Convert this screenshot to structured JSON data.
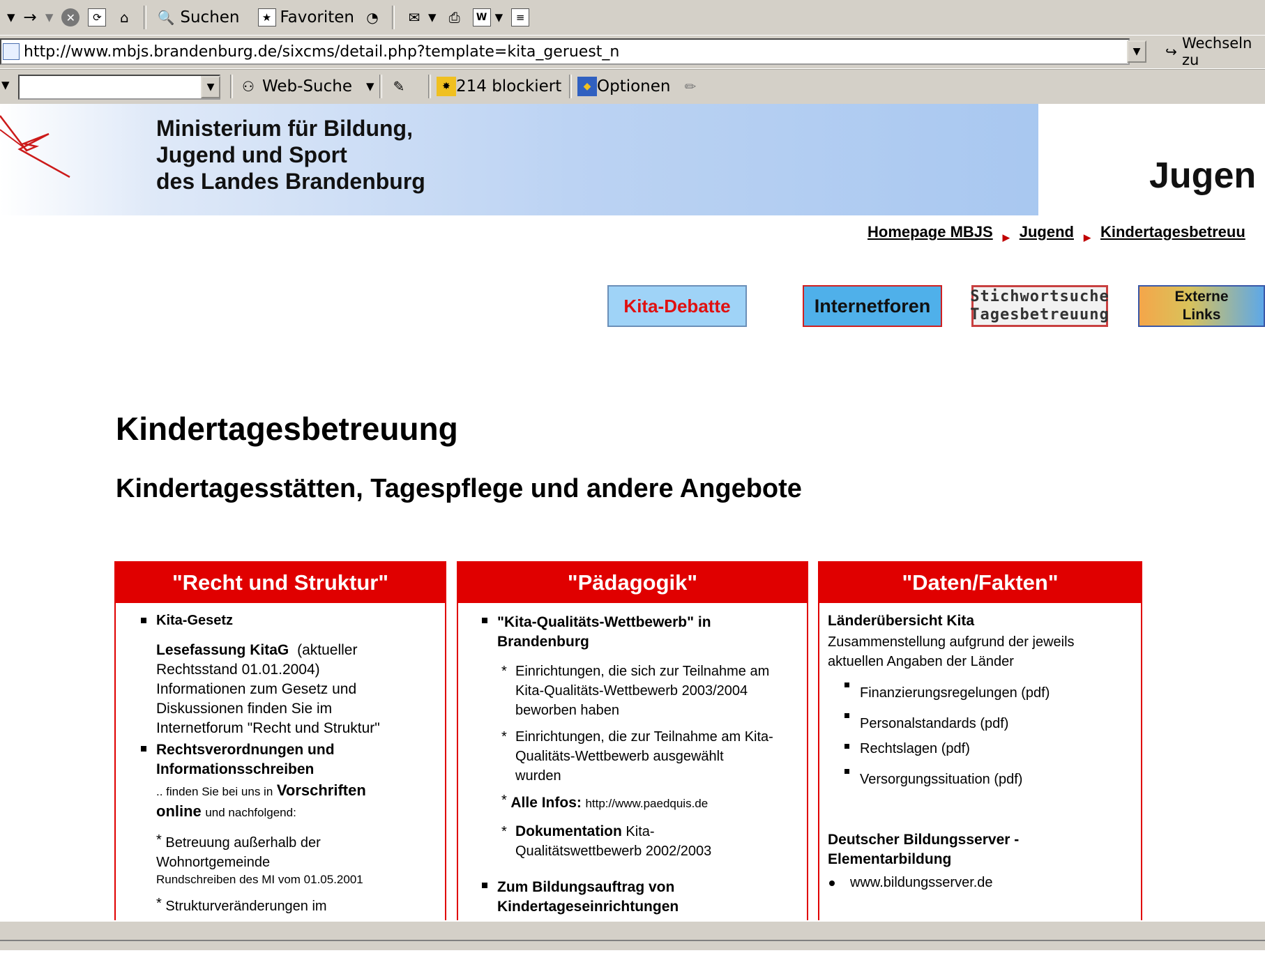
{
  "browser": {
    "toolbar": {
      "search_label": "Suchen",
      "favorites_label": "Favoriten"
    },
    "address": {
      "url": "http://www.mbjs.brandenburg.de/sixcms/detail.php?template=kita_geruest_n",
      "go_label": "Wechseln zu"
    },
    "searchbar": {
      "websuche_label": "Web-Suche",
      "blocked_label": "214 blockiert",
      "options_label": "Optionen"
    }
  },
  "banner": {
    "ministry_line1": "Ministerium für Bildung,",
    "ministry_line2": "Jugend und Sport",
    "ministry_line3": "des Landes Brandenburg",
    "section_title": "Jugen"
  },
  "breadcrumb": {
    "items": [
      "Homepage MBJS",
      "Jugend",
      "Kindertagesbetreuu"
    ]
  },
  "nav": {
    "kita_debatte": "Kita-Debatte",
    "internetforen": "Internetforen",
    "stichwort_line1": "Stichwortsuche",
    "stichwort_line2": "Tagesbetreuung",
    "externe_line1": "Externe",
    "externe_line2": "Links"
  },
  "headings": {
    "title": "Kindertagesbetreuung",
    "subtitle": "Kindertagesstätten, Tagespflege und andere Angebote"
  },
  "columns": {
    "recht": {
      "header": "\"Recht und Struktur\"",
      "kita_gesetz": "Kita-Gesetz",
      "lesefassung": "Lesefassung KitaG",
      "lesefassung_note": "(aktueller",
      "rechtsstand": "Rechtsstand 01.01.2004)",
      "info1": "Informationen zum Gesetz und",
      "info2": "Diskussionen finden Sie im",
      "info3": "Internetforum \"Recht und Struktur\"",
      "rv1": "Rechtsverordnungen und",
      "rv2": "Informationsschreiben",
      "finden_pre": ".. finden Sie bei uns in",
      "vorschriften": "Vorschriften",
      "online": "online",
      "finden_post": "und nachfolgend:",
      "betreuung1": "Betreuung außerhalb der",
      "betreuung2": "Wohnortgemeinde",
      "rundschreiben": "Rundschreiben des MI vom 01.05.2001",
      "struktur": "Strukturveränderungen im"
    },
    "paed": {
      "header": "\"Pädagogik\"",
      "wettbewerb1": "\"Kita-Qualitäts-Wettbewerb\" in",
      "wettbewerb2": "Brandenburg",
      "e1_1": "Einrichtungen, die sich zur Teilnahme am",
      "e1_2": "Kita-Qualitäts-Wettbewerb 2003/2004",
      "e1_3": "beworben haben",
      "e2_1": "Einrichtungen, die zur Teilnahme am Kita-",
      "e2_2": "Qualitäts-Wettbewerb ausgewählt",
      "e2_3": "wurden",
      "alle_infos": "Alle Infos:",
      "alle_infos_url": "http://www.paedquis.de",
      "doku": "Dokumentation",
      "doku_rest1": "Kita-",
      "doku_rest2": "Qualitätswettbewerb 2002/2003",
      "bildung1": "Zum Bildungsauftrag von",
      "bildung2": "Kindertageseinrichtungen"
    },
    "daten": {
      "header": "\"Daten/Fakten\"",
      "laender": "Länderübersicht Kita",
      "zus1": "Zusammenstellung aufgrund der jeweils",
      "zus2": "aktuellen Angaben der Länder",
      "items": [
        "Finanzierungsregelungen (pdf)",
        "Personalstandards (pdf)",
        "Rechtslagen (pdf)",
        "Versorgungssituation (pdf)"
      ],
      "dbs1": "Deutscher Bildungsserver -",
      "dbs2": "Elementarbildung",
      "dbs_link": "www.bildungsserver.de"
    }
  }
}
